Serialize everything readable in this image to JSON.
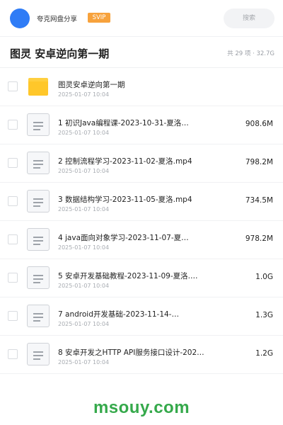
{
  "header": {
    "share_name": "夸克网盘分享",
    "badge": "SVIP",
    "search_placeholder": "搜索"
  },
  "folder": {
    "title": "图灵 安卓逆向第一期",
    "summary": "共 29 项 · 32.7G"
  },
  "items": [
    {
      "type": "folder",
      "icon": "folder-icon",
      "name": "图灵安卓逆向第一期",
      "date": "2025-01-07 10:04",
      "size": ""
    },
    {
      "type": "file",
      "icon": "file-icon",
      "name": "1 初识Java编程课-2023-10-31-夏洛…",
      "date": "2025-01-07 10:04",
      "size": "908.6M"
    },
    {
      "type": "file",
      "icon": "file-icon",
      "name": "2 控制流程学习-2023-11-02-夏洛.mp4",
      "date": "2025-01-07 10:04",
      "size": "798.2M"
    },
    {
      "type": "file",
      "icon": "file-icon",
      "name": "3 数据结构学习-2023-11-05-夏洛.mp4",
      "date": "2025-01-07 10:04",
      "size": "734.5M"
    },
    {
      "type": "file",
      "icon": "file-icon",
      "name": "4 java面向对象学习-2023-11-07-夏…",
      "date": "2025-01-07 10:04",
      "size": "978.2M"
    },
    {
      "type": "file",
      "icon": "file-icon",
      "name": "5 安卓开发基础教程-2023-11-09-夏洛.…",
      "date": "2025-01-07 10:04",
      "size": "1.0G"
    },
    {
      "type": "file",
      "icon": "file-icon",
      "name": "7 android开发基础-2023-11-14-…",
      "date": "2025-01-07 10:04",
      "size": "1.3G"
    },
    {
      "type": "file",
      "icon": "file-icon",
      "name": "8 安卓开发之HTTP API服务接口设计-202…",
      "date": "2025-01-07 10:04",
      "size": "1.2G"
    }
  ],
  "watermark": "msouy.com",
  "colors": {
    "avatar": "#2f7cf6",
    "badge": "#f7a23c",
    "folder": "#ffc72a",
    "watermark": "#35a94b"
  }
}
